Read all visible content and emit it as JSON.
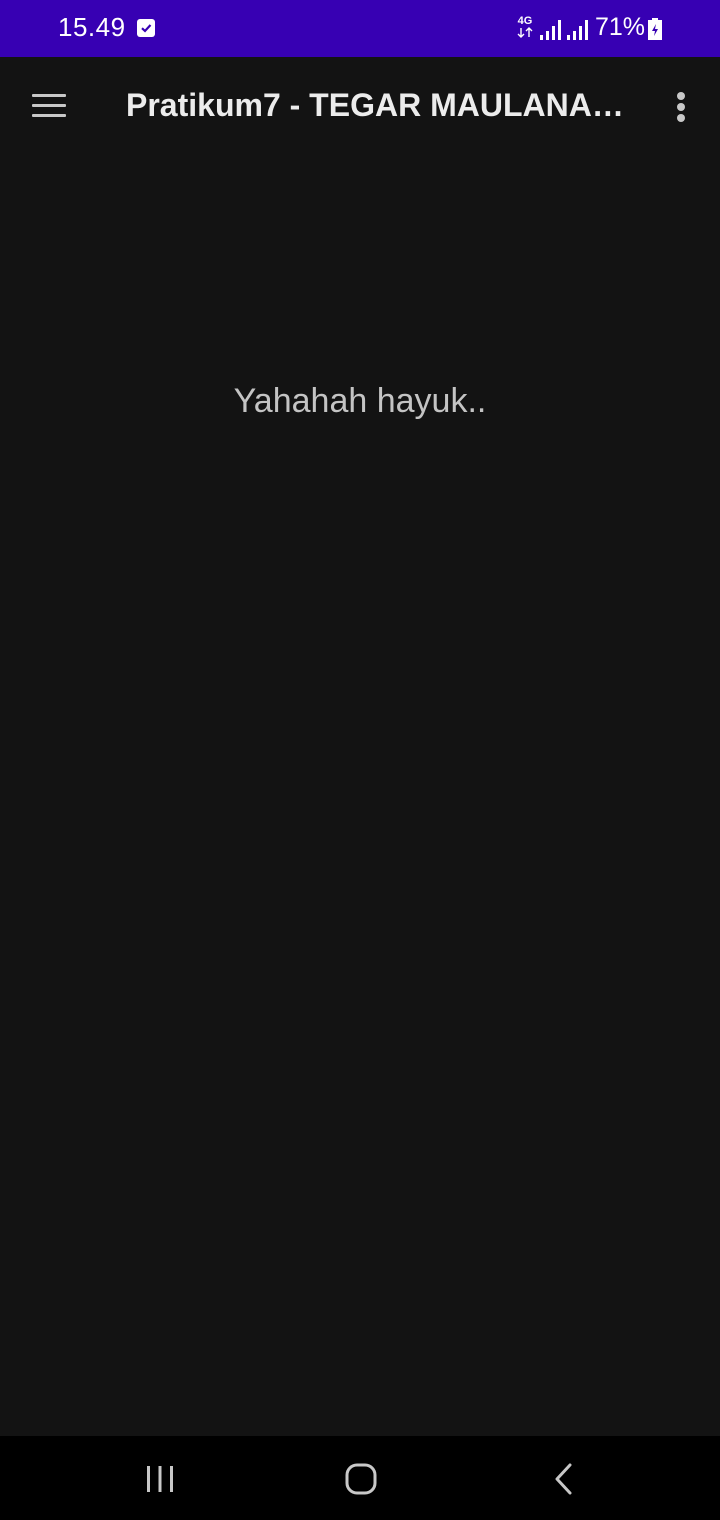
{
  "status_bar": {
    "time": "15.49",
    "network_type": "4G",
    "battery_percent": "71%",
    "battery_level": 0.71,
    "background_color": "#3700b3",
    "icons": [
      "checkbox-notification-icon",
      "data-arrows-icon",
      "signal-icon",
      "signal-icon",
      "battery-charging-icon"
    ]
  },
  "app_bar": {
    "title": "Pratikum7 - TEGAR MAULANA…",
    "menu_icon": "hamburger-menu-icon",
    "overflow_icon": "more-vertical-icon"
  },
  "content": {
    "message": "Yahahah hayuk.."
  },
  "nav_bar": {
    "icons": [
      "recent-apps-icon",
      "home-icon",
      "back-icon"
    ]
  },
  "colors": {
    "background": "#131313",
    "text_primary": "#ececec",
    "text_secondary": "#c4c4c4"
  }
}
